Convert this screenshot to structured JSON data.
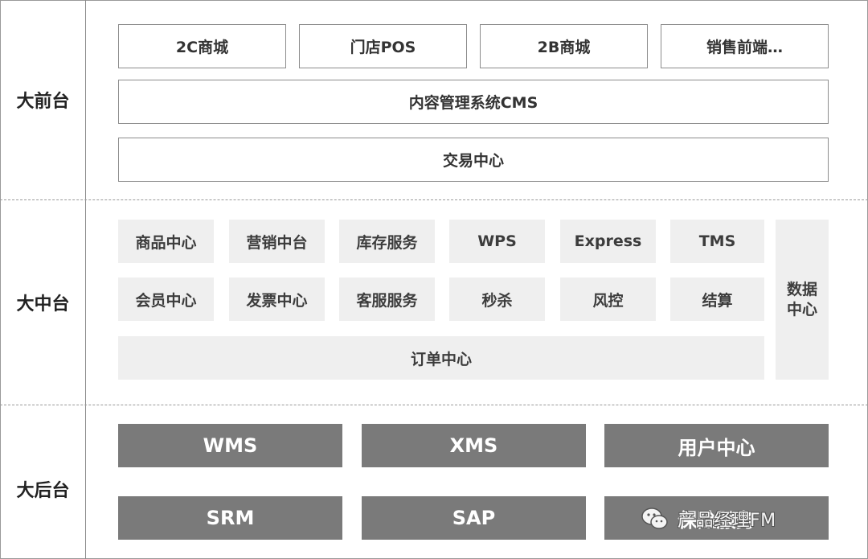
{
  "layers": {
    "front_label": "大前台",
    "middle_label": "大中台",
    "back_label": "大后台"
  },
  "front": {
    "channels": [
      "2C商城",
      "门店POS",
      "2B商城",
      "销售前端…"
    ],
    "cms": "内容管理系统CMS",
    "trade": "交易中心"
  },
  "middle": {
    "row1": [
      "商品中心",
      "营销中台",
      "库存服务",
      "WPS",
      "Express",
      "TMS"
    ],
    "row2": [
      "会员中心",
      "发票中心",
      "客服服务",
      "秒杀",
      "风控",
      "结算"
    ],
    "order": "订单中心",
    "data_center": "数据中心"
  },
  "back": {
    "row1": [
      "WMS",
      "XMS",
      "用户中心"
    ],
    "row2": [
      "SRM",
      "SAP",
      "保险服务"
    ]
  },
  "watermark": {
    "text": "产品经理FM",
    "icon": "wechat-icon"
  },
  "colors": {
    "dark_box": "#7a7a7a",
    "light_box": "#efefef",
    "border": "#8c8c8c"
  }
}
